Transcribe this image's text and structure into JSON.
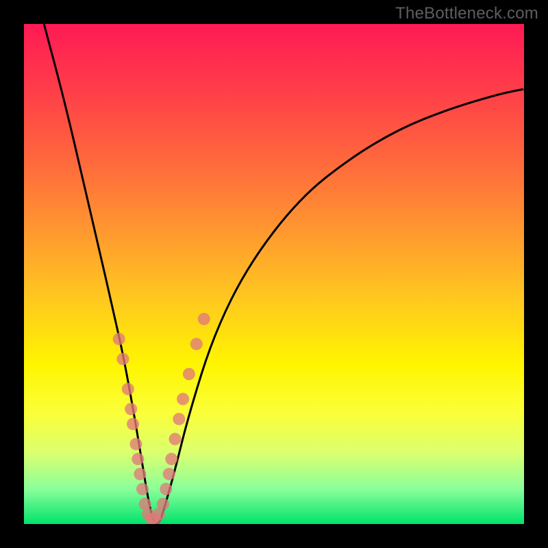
{
  "watermark": "TheBottleneck.com",
  "colors": {
    "frame": "#000000",
    "curve": "#000000",
    "dot": "#e07a7a",
    "gradient_stops": [
      "#ff1a55",
      "#ff3a4a",
      "#ff6a3c",
      "#ff9a2f",
      "#ffc81f",
      "#fff500",
      "#faff3a",
      "#d9ff70",
      "#8aff9a",
      "#00e36b"
    ]
  },
  "chart_data": {
    "type": "line",
    "title": "",
    "xlabel": "",
    "ylabel": "",
    "xlim": [
      0,
      100
    ],
    "ylim": [
      0,
      100
    ],
    "note": "V-shaped bottleneck curve; y=0 is the optimal (green) zone at bottom, y=100 is worst (red) at top. Values are visual estimates.",
    "series": [
      {
        "name": "bottleneck-curve",
        "x": [
          4,
          8,
          12,
          15,
          18,
          20,
          22,
          23.5,
          25,
          26,
          27,
          28,
          30,
          33,
          38,
          45,
          55,
          65,
          75,
          85,
          95,
          100
        ],
        "y": [
          100,
          85,
          68,
          55,
          42,
          33,
          22,
          13,
          4,
          0,
          0,
          3,
          10,
          22,
          38,
          52,
          65,
          73,
          79,
          83,
          86,
          87
        ]
      }
    ],
    "highlight_points": {
      "name": "salmon-dots",
      "points": [
        {
          "x": 19.0,
          "y": 37
        },
        {
          "x": 19.8,
          "y": 33
        },
        {
          "x": 20.8,
          "y": 27
        },
        {
          "x": 21.4,
          "y": 23
        },
        {
          "x": 21.8,
          "y": 20
        },
        {
          "x": 22.4,
          "y": 16
        },
        {
          "x": 22.8,
          "y": 13
        },
        {
          "x": 23.2,
          "y": 10
        },
        {
          "x": 23.7,
          "y": 7
        },
        {
          "x": 24.2,
          "y": 4
        },
        {
          "x": 24.8,
          "y": 2
        },
        {
          "x": 25.5,
          "y": 1
        },
        {
          "x": 26.2,
          "y": 1
        },
        {
          "x": 27.0,
          "y": 2
        },
        {
          "x": 27.8,
          "y": 4
        },
        {
          "x": 28.4,
          "y": 7
        },
        {
          "x": 29.0,
          "y": 10
        },
        {
          "x": 29.5,
          "y": 13
        },
        {
          "x": 30.2,
          "y": 17
        },
        {
          "x": 31.0,
          "y": 21
        },
        {
          "x": 31.8,
          "y": 25
        },
        {
          "x": 33.0,
          "y": 30
        },
        {
          "x": 34.5,
          "y": 36
        },
        {
          "x": 36.0,
          "y": 41
        }
      ]
    }
  }
}
